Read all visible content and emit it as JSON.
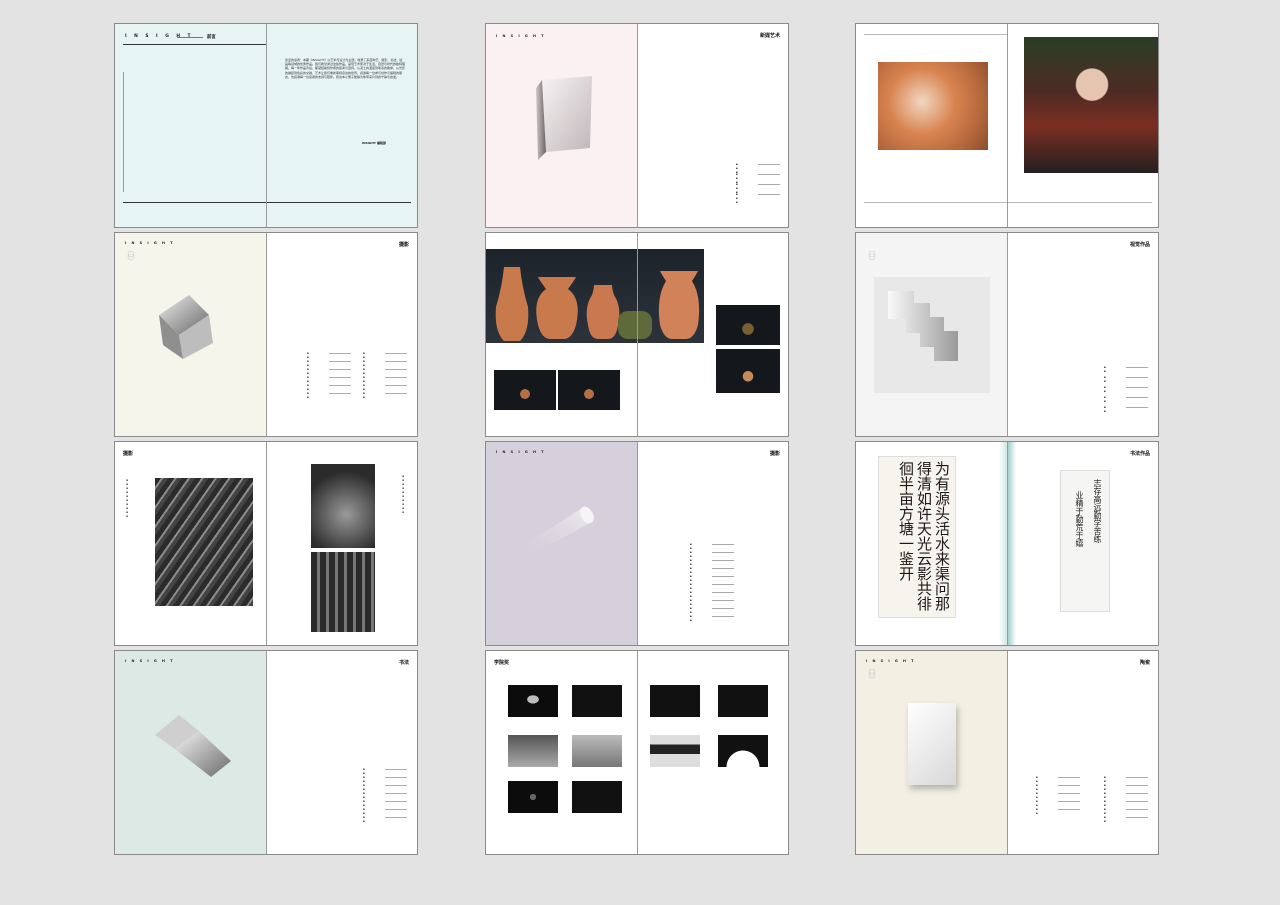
{
  "brand": "I N S I G H T",
  "spreads": {
    "s1": {
      "section": "前言",
      "body": "亲爱的读者：本期《INSIGHT》以艺术与设计为主题，收录了来自陶艺、摄影、书法、绘画等领域的优秀作品。我们希望通过这些作品，呈现艺术家对于生活、自然与时代的独特理解。每一件作品背后，都凝结着创作者的思考与坚持。从泥土的温度到笔墨的韵律，从光影的捕捉到色彩的交融，艺术让我们重新审视身边的世界。感谢每一位参与创作与编辑的朋友，也感谢每一位读者的支持与陪伴。愿这本小册子能够为你带来片刻的宁静与启发。",
      "sign": "INSIGHT 编辑部"
    },
    "s2": {
      "title": "新媒艺术"
    },
    "s4": {
      "title": "摄影"
    },
    "s6": {
      "title": "视觉作品"
    },
    "s7": {
      "title": "摄影"
    },
    "s8": {
      "title": "摄影"
    },
    "s9": {
      "title": "书法作品",
      "calligraphy_left": "为有源头活水来渠问那得清如许天光云影共徘徊半亩方塘一鉴开",
      "calligraphy_right1": "志存高远勤学苦练",
      "calligraphy_right2": "业精于勤荒于嬉"
    },
    "s10": {
      "title": "书法"
    },
    "s11": {
      "title": "学院奖"
    },
    "s12": {
      "title": "陶瓷"
    }
  },
  "colors": {
    "mint": "#e7f4f4",
    "pink": "#fbf1f3",
    "cream": "#f6f5ec",
    "lavender": "#d6cfdc",
    "sage": "#dde9e4",
    "beige": "#f3efe2"
  },
  "icons": [
    "stack-circles-icon"
  ]
}
